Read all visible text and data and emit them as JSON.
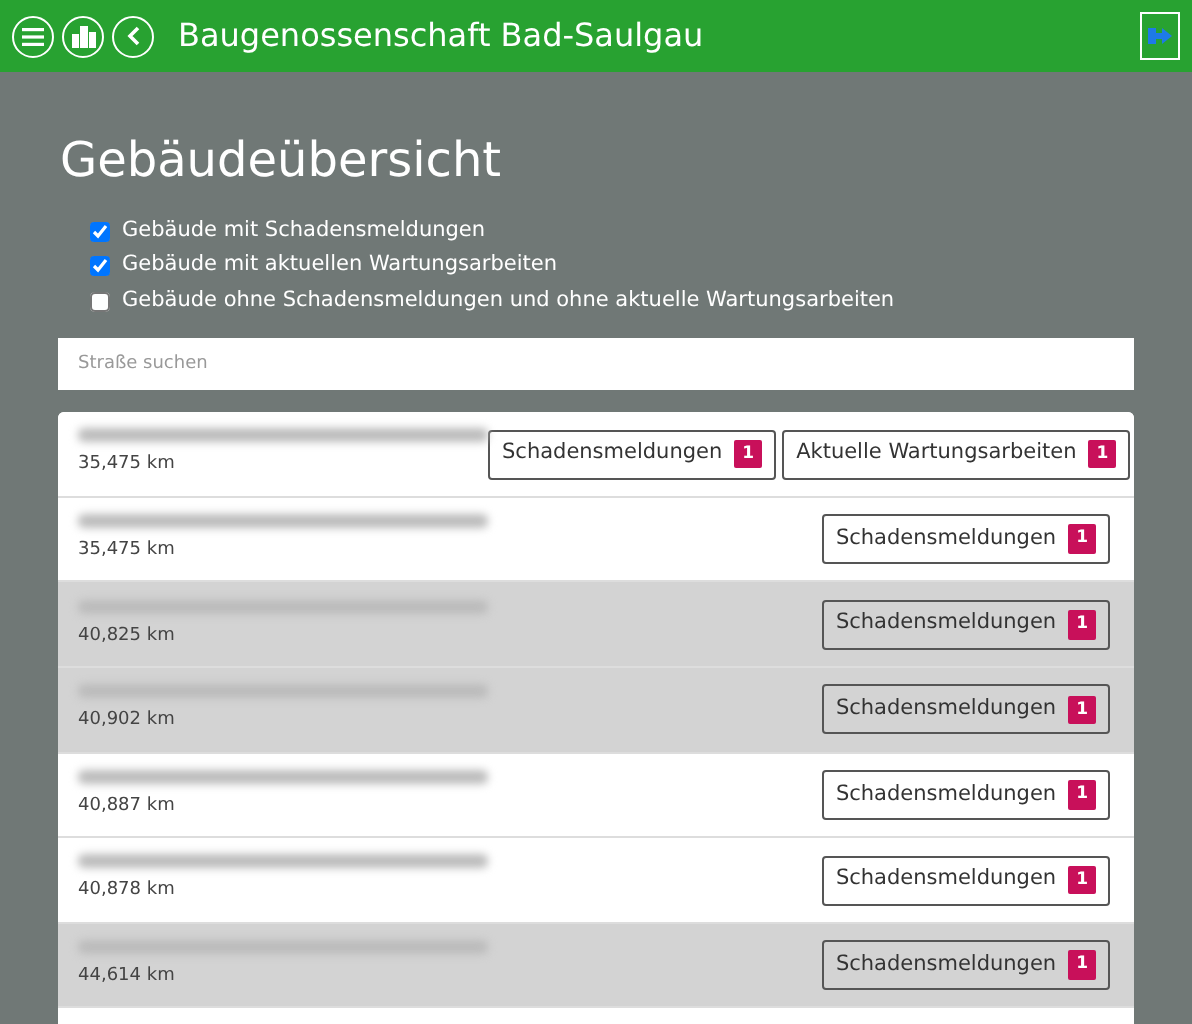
{
  "app_bar": {
    "title": "Baugenossenschaft Bad-Saulgau"
  },
  "page_title": "Gebäudeübersicht",
  "filters": [
    {
      "label": "Gebäude mit Schadensmeldungen",
      "checked": true
    },
    {
      "label": "Gebäude mit aktuellen Wartungsarbeiten",
      "checked": true
    },
    {
      "label": "Gebäude ohne Schadensmeldungen und ohne aktuelle Wartungsarbeiten",
      "checked": false
    }
  ],
  "search": {
    "placeholder": "Straße suchen"
  },
  "buildings": [
    {
      "distance": "35,475 km",
      "highlighted": false,
      "buttons": [
        {
          "label": "Schadensmeldungen",
          "count": "1"
        },
        {
          "label": "Aktuelle Wartungsarbeiten",
          "count": "1"
        }
      ]
    },
    {
      "distance": "35,475 km",
      "highlighted": false,
      "buttons": [
        {
          "label": "Schadensmeldungen",
          "count": "1"
        }
      ]
    },
    {
      "distance": "40,825 km",
      "highlighted": true,
      "buttons": [
        {
          "label": "Schadensmeldungen",
          "count": "1"
        }
      ]
    },
    {
      "distance": "40,902 km",
      "highlighted": true,
      "buttons": [
        {
          "label": "Schadensmeldungen",
          "count": "1"
        }
      ]
    },
    {
      "distance": "40,887 km",
      "highlighted": false,
      "buttons": [
        {
          "label": "Schadensmeldungen",
          "count": "1"
        }
      ]
    },
    {
      "distance": "40,878 km",
      "highlighted": false,
      "buttons": [
        {
          "label": "Schadensmeldungen",
          "count": "1"
        }
      ]
    },
    {
      "distance": "44,614 km",
      "highlighted": true,
      "buttons": [
        {
          "label": "Schadensmeldungen",
          "count": "1"
        }
      ]
    }
  ]
}
